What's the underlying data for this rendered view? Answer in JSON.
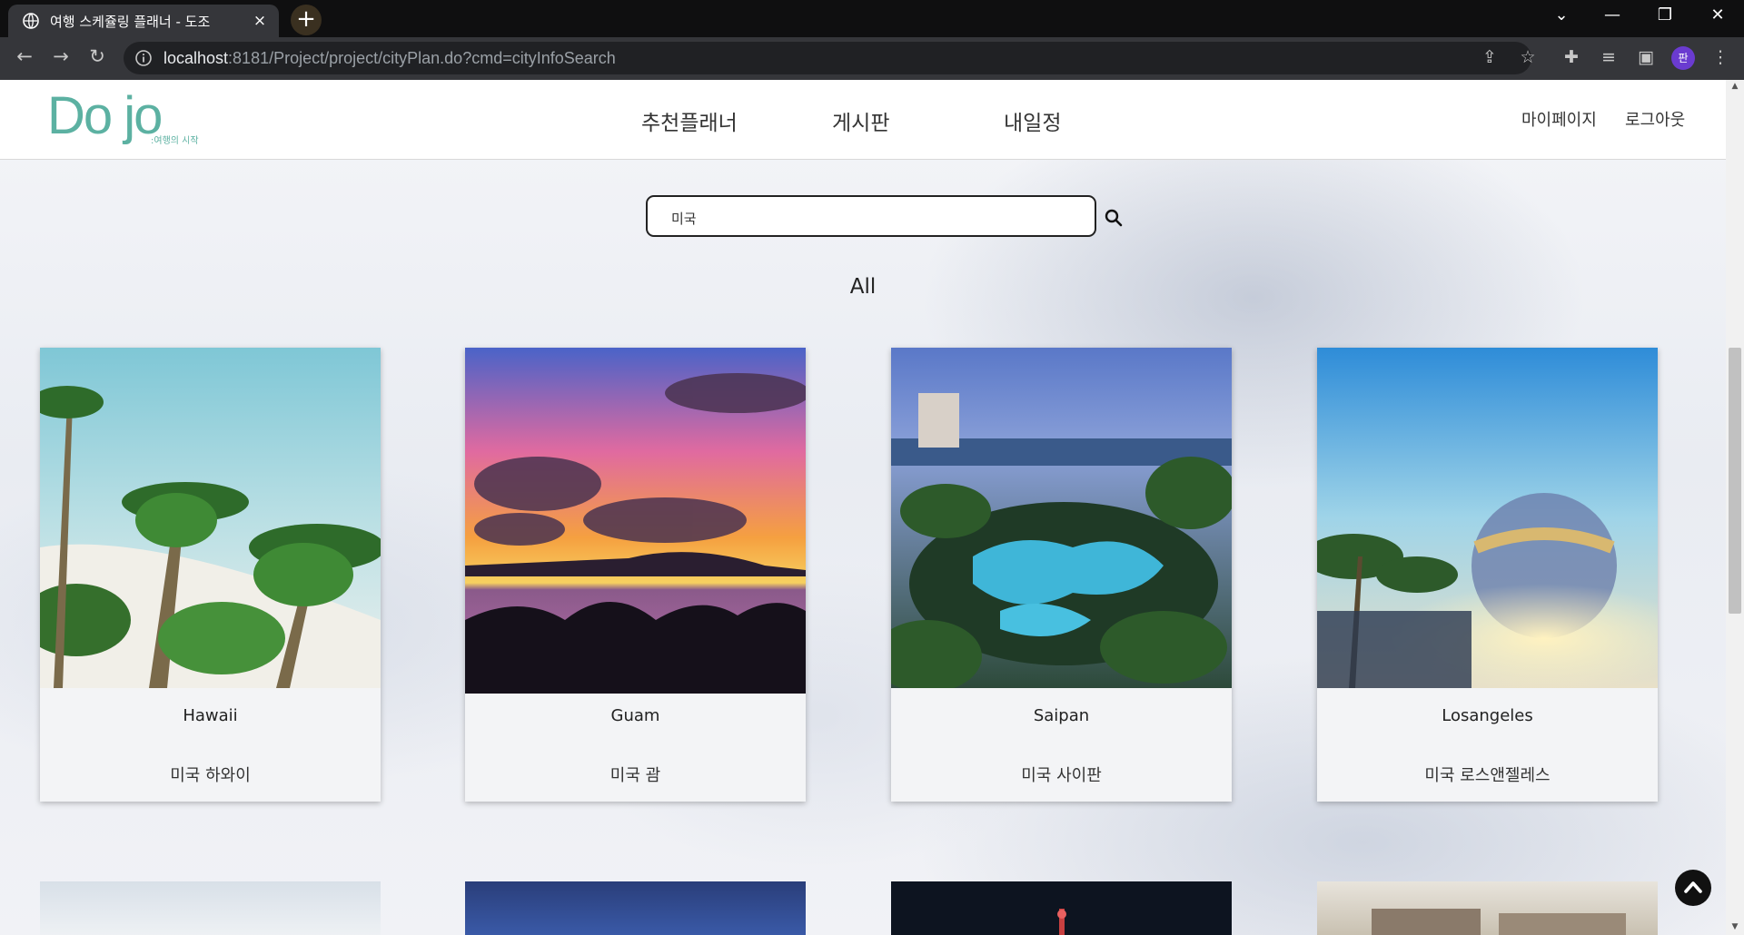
{
  "browser": {
    "tab_title": "여행 스케쥴링 플래너 - 도조",
    "tab_close": "×",
    "new_tab": "+",
    "url_host": "localhost",
    "url_rest": ":8181/Project/project/cityPlan.do?cmd=cityInfoSearch",
    "profile_initial": "판"
  },
  "site": {
    "logo": "Do jo",
    "logo_tagline": ":여행의 시작",
    "menu": [
      "추천플래너",
      "게시판",
      "내일정"
    ],
    "util": [
      "마이페이지",
      "로그아웃"
    ]
  },
  "search": {
    "value": "미국"
  },
  "section_title": "All",
  "cards": [
    {
      "name": "Hawaii",
      "desc": "미국 하와이"
    },
    {
      "name": "Guam",
      "desc": "미국 괌"
    },
    {
      "name": "Saipan",
      "desc": "미국 사이판"
    },
    {
      "name": "Losangeles",
      "desc": "미국 로스앤젤레스"
    }
  ],
  "colors": {
    "brand": "#5cb1a2",
    "chrome_dark": "#35363a",
    "tab_strip": "#0f0f10"
  }
}
